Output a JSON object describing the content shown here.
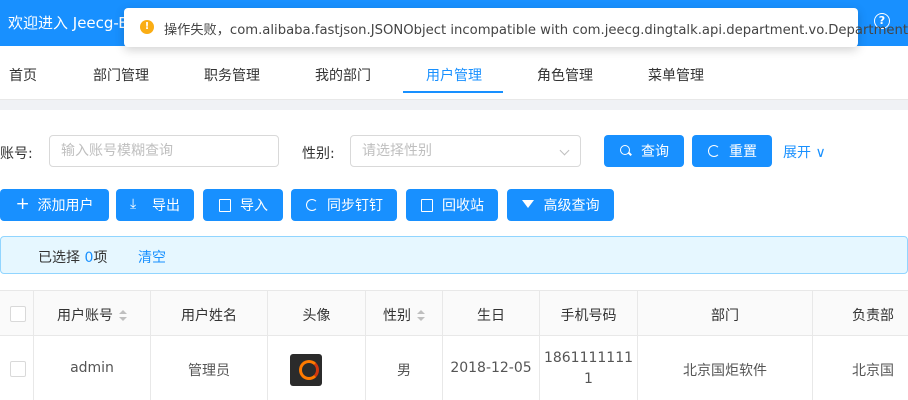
{
  "header": {
    "title": "欢迎进入 Jeecg-B"
  },
  "toast": {
    "message": "操作失败，com.alibaba.fastjson.JSONObject incompatible with com.jeecg.dingtalk.api.department.vo.Department"
  },
  "tabs": [
    "首页",
    "部门管理",
    "职务管理",
    "我的部门",
    "用户管理",
    "角色管理",
    "菜单管理"
  ],
  "search": {
    "account_label": "账号:",
    "account_placeholder": "输入账号模糊查询",
    "gender_label": "性别:",
    "gender_placeholder": "请选择性别",
    "query_label": "查询",
    "reset_label": "重置",
    "expand_label": "展开"
  },
  "toolbar": {
    "add_label": "添加用户",
    "export_label": "导出",
    "import_label": "导入",
    "sync_label": "同步钉钉",
    "recycle_label": "回收站",
    "advanced_label": "高级查询"
  },
  "selection": {
    "prefix": "已选择 ",
    "count": "0",
    "suffix": "项",
    "clear_label": "清空"
  },
  "table": {
    "columns": [
      "用户账号",
      "用户姓名",
      "头像",
      "性别",
      "生日",
      "手机号码",
      "部门",
      "负责部"
    ],
    "rows": [
      {
        "account": "admin",
        "name": "管理员",
        "gender": "男",
        "birthday": "2018-12-05",
        "phone_line1": "1861111111",
        "phone_line2": "1",
        "dept": "北京国炬软件",
        "lead_dept": "北京国"
      }
    ]
  },
  "colors": {
    "primary": "#1890ff",
    "warning": "#faad14",
    "alert_bg": "#e6f7ff"
  }
}
